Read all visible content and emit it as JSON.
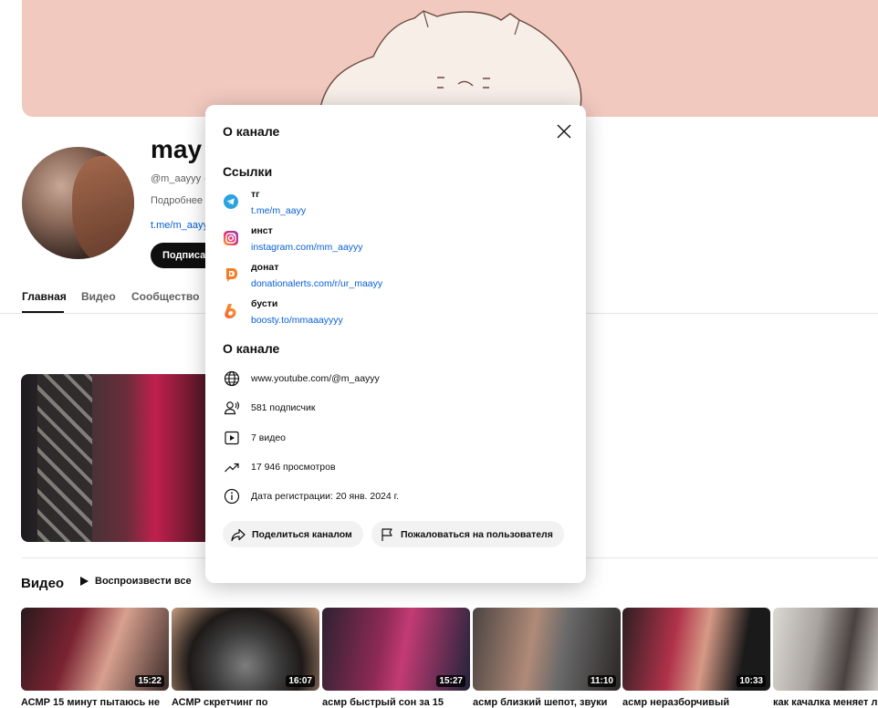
{
  "channel": {
    "name": "may",
    "handle": "@m_aayyy ·",
    "more": "Подробнее о",
    "link": "t.me/m_aayy",
    "subscribe_label": "Подписать"
  },
  "tabs": [
    "Главная",
    "Видео",
    "Сообщество"
  ],
  "videos_section": {
    "title": "Видео",
    "play_all": "Воспроизвести все",
    "items": [
      {
        "title": "АСМР 15 минут пытаюсь не",
        "duration": "15:22"
      },
      {
        "title": "АСМР скретчинг по",
        "duration": "16:07"
      },
      {
        "title": "асмр быстрый сон за 15",
        "duration": "15:27"
      },
      {
        "title": "асмр близкий шепот, звуки",
        "duration": "11:10"
      },
      {
        "title": "асмр неразборчивый",
        "duration": "10:33"
      },
      {
        "title": "как качалка меняет ли",
        "duration": ""
      }
    ]
  },
  "modal": {
    "title": "О канале",
    "links_heading": "Ссылки",
    "links": [
      {
        "name": "тг",
        "url": "t.me/m_aayy",
        "icon": "telegram-icon"
      },
      {
        "name": "инст",
        "url": "instagram.com/mm_aayyy",
        "icon": "instagram-icon"
      },
      {
        "name": "донат",
        "url": "donationalerts.com/r/ur_maayy",
        "icon": "donationalerts-icon"
      },
      {
        "name": "бусти",
        "url": "boosty.to/mmaaayyyy",
        "icon": "boosty-icon"
      }
    ],
    "about_heading": "О канале",
    "details": [
      {
        "text": "www.youtube.com/@m_aayyy",
        "icon": "globe-icon"
      },
      {
        "text": "581 подписчик",
        "icon": "subscribers-icon"
      },
      {
        "text": "7 видео",
        "icon": "video-icon"
      },
      {
        "text": "17 946 просмотров",
        "icon": "trending-icon"
      },
      {
        "text": "Дата регистрации: 20 янв. 2024 г.",
        "icon": "info-icon"
      }
    ],
    "share_label": "Поделиться каналом",
    "report_label": "Пожаловаться на пользователя"
  },
  "colors": {
    "banner": "#f1c9bf",
    "link": "#065fd4",
    "telegram": "#2aa3df",
    "donationalerts": "#f57c22",
    "boosty": "#f0612d"
  }
}
